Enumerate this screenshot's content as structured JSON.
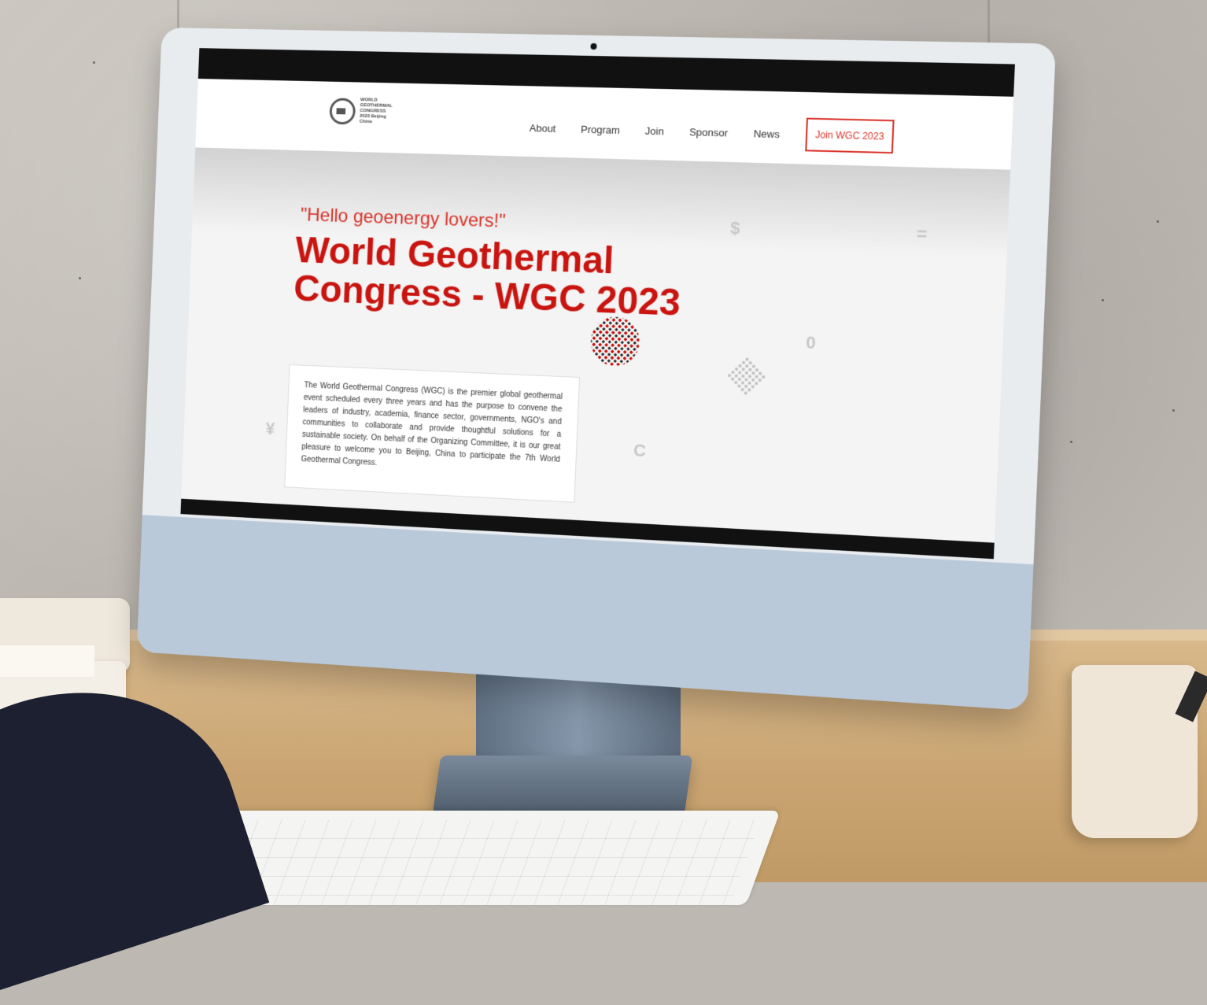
{
  "site": {
    "logo_lines": [
      "WORLD",
      "GEOTHERMAL",
      "CONGRESS",
      "2023 Beijing China"
    ],
    "nav": {
      "items": [
        "About",
        "Program",
        "Join",
        "Sponsor",
        "News"
      ],
      "cta_label": "Join WGC 2023"
    },
    "hero": {
      "greeting": "\"Hello geoenergy lovers!\"",
      "title": "World Geothermal Congress - WGC 2023",
      "description": "The World Geothermal Congress (WGC) is the premier global geothermal event scheduled every three years and has the purpose to convene the leaders of industry, academia, finance sector, governments, NGO's and communities to collaborate and provide thoughtful solutions for a sustainable society. On behalf of the Organizing Committee, it is our great pleasure to welcome you to Beijing, China to participate the 7th World Geothermal Congress."
    },
    "decorations": {
      "symbols": [
        "$",
        "=",
        "0",
        "¥",
        "C"
      ]
    }
  },
  "colors": {
    "accent": "#d9342b",
    "title": "#c9140f",
    "monitor_chin": "#b9c9da"
  }
}
